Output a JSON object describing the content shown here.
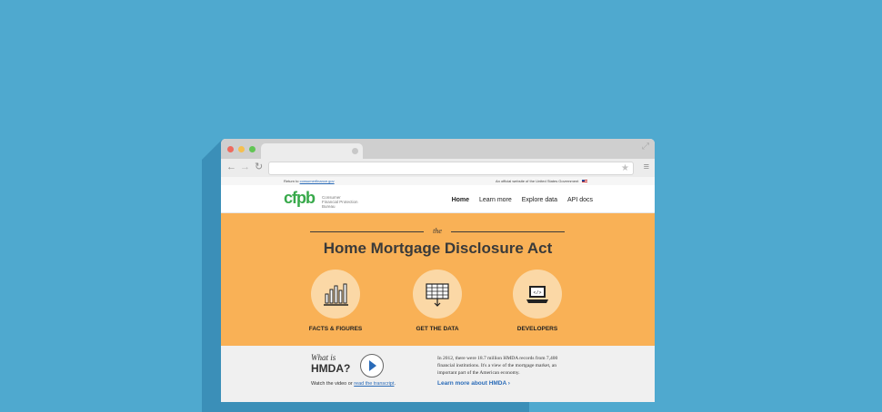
{
  "browser": {
    "expand_glyph": "⤢",
    "back_glyph": "←",
    "forward_glyph": "→",
    "reload_glyph": "↻",
    "star_glyph": "★",
    "menu_glyph": "≡",
    "url": ""
  },
  "govbar": {
    "return_prefix": "Return to ",
    "return_link": "consumerfinance.gov",
    "official": "An official website of the United States Government"
  },
  "header": {
    "logo": "cfpb",
    "logo_sub": "Consumer Financial Protection Bureau",
    "nav": [
      "Home",
      "Learn more",
      "Explore data",
      "API docs"
    ]
  },
  "hero": {
    "eyebrow": "the",
    "title": "Home Mortgage Disclosure Act",
    "features": [
      {
        "label": "FACTS & FIGURES",
        "icon": "bar-chart-icon"
      },
      {
        "label": "GET THE DATA",
        "icon": "data-table-icon"
      },
      {
        "label": "DEVELOPERS",
        "icon": "laptop-code-icon"
      }
    ]
  },
  "video": {
    "what_is": "What is",
    "hmda": "HMDA?",
    "watch_prefix": "Watch the video or ",
    "transcript_link": "read the transcript",
    "watch_suffix": "."
  },
  "about": {
    "description": "In 2012, there were 18.7 million HMDA records from 7,400 financial institutions. It's a view of the mortgage market, an important part of the American economy.",
    "learn_link": "Learn more about HMDA ›"
  },
  "colors": {
    "background": "#4fa9cf",
    "hero": "#f9b156",
    "logo_green": "#37a94a",
    "link_blue": "#2a6bb8"
  }
}
